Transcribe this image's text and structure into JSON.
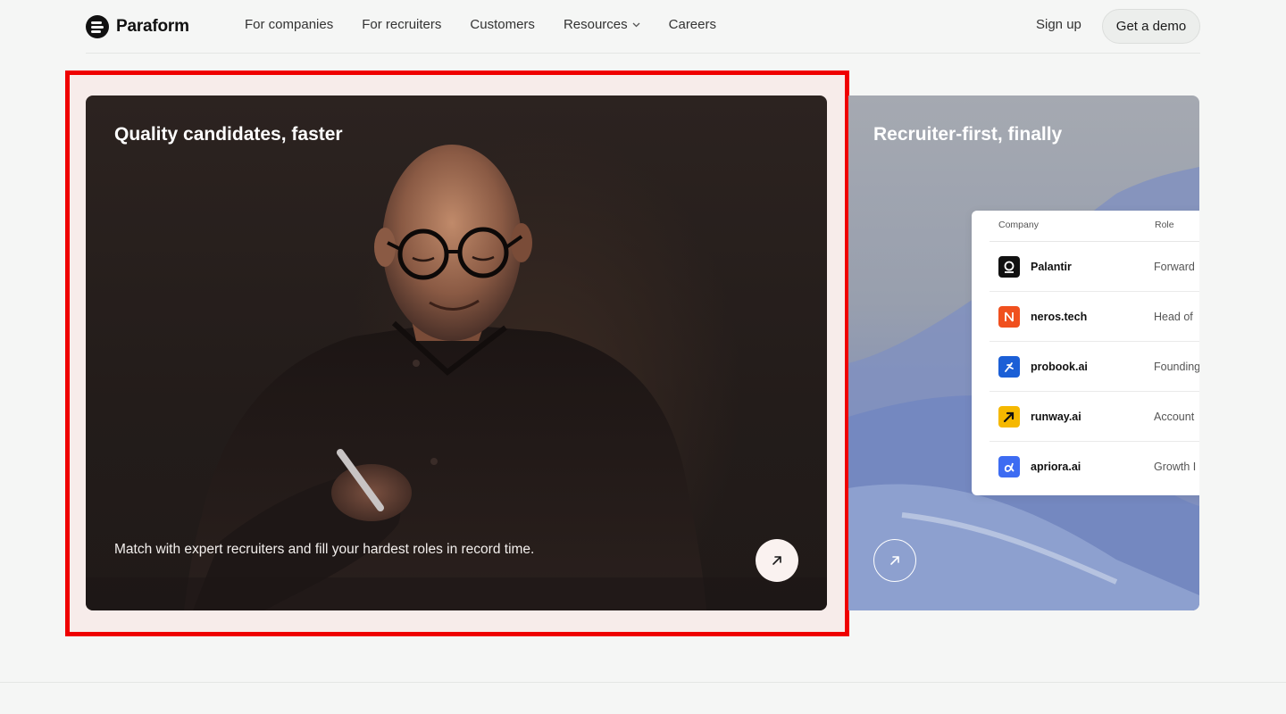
{
  "brand": {
    "name": "Paraform"
  },
  "nav": {
    "items": [
      {
        "label": "For companies"
      },
      {
        "label": "For recruiters"
      },
      {
        "label": "Customers"
      },
      {
        "label": "Resources",
        "has_dropdown": true
      },
      {
        "label": "Careers"
      }
    ],
    "signup_label": "Sign up",
    "demo_label": "Get a demo"
  },
  "cards": {
    "main": {
      "title": "Quality candidates, faster",
      "description": "Match with expert recruiters and fill your hardest roles in record time."
    },
    "secondary": {
      "title": "Recruiter-first, finally",
      "table": {
        "headers": {
          "company": "Company",
          "role": "Role"
        },
        "rows": [
          {
            "company": "Palantir",
            "role": "Forward",
            "icon": "palantir-icon",
            "color": "#111111"
          },
          {
            "company": "neros.tech",
            "role": "Head of",
            "icon": "neros-icon",
            "color": "#f0501e"
          },
          {
            "company": "probook.ai",
            "role": "Founding",
            "icon": "probook-icon",
            "color": "#1b5fd6"
          },
          {
            "company": "runway.ai",
            "role": "Account",
            "icon": "runway-icon",
            "color": "#f5b800"
          },
          {
            "company": "apriora.ai",
            "role": "Growth I",
            "icon": "apriora-icon",
            "color": "#3d6cf2"
          }
        ]
      }
    }
  },
  "colors": {
    "page_bg": "#f5f6f5",
    "highlight": "#ef0000",
    "card_dark": "#231c1a"
  }
}
